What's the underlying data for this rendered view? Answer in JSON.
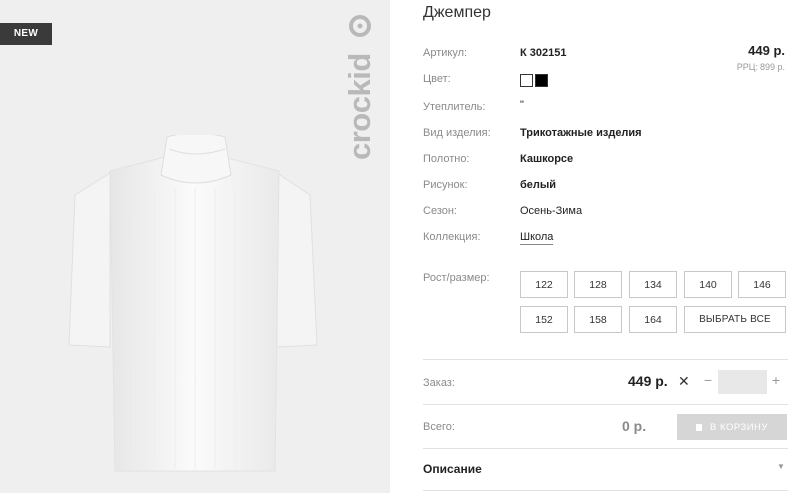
{
  "badge": {
    "label": "NEW"
  },
  "brand": {
    "name": "crockid"
  },
  "product": {
    "title": "Джемпер",
    "price": "449 р.",
    "rrp_label": "РРЦ:",
    "rrp_value": "899 р."
  },
  "attributes": [
    {
      "label": "Артикул:",
      "value": "К 302151"
    },
    {
      "label": "Цвет:",
      "value": ""
    },
    {
      "label": "Утеплитель:",
      "value": "\""
    },
    {
      "label": "Вид изделия:",
      "value": "Трикотажные изделия"
    },
    {
      "label": "Полотно:",
      "value": "Кашкорсе"
    },
    {
      "label": "Рисунок:",
      "value": "белый"
    },
    {
      "label": "Сезон:",
      "value": "Осень-Зима"
    },
    {
      "label": "Коллекция:",
      "value": "Школа"
    }
  ],
  "colors": {
    "swatch_1": "#ffffff",
    "swatch_2": "#000000",
    "cart_button": "#d6d6d6",
    "badge": "#3a3a3a"
  },
  "sizes": {
    "label": "Рост/размер:",
    "options": [
      "122",
      "128",
      "134",
      "140",
      "146",
      "152",
      "158",
      "164"
    ],
    "select_all": "ВЫБРАТЬ ВСЕ"
  },
  "order": {
    "label": "Заказ:",
    "price": "449 р.",
    "times": "✕",
    "minus": "−",
    "plus": "+",
    "quantity": ""
  },
  "total": {
    "label": "Всего:",
    "value": "0 р.",
    "cart_button": "В КОРЗИНУ"
  },
  "description": {
    "title": "Описание",
    "chevron": "▼"
  }
}
